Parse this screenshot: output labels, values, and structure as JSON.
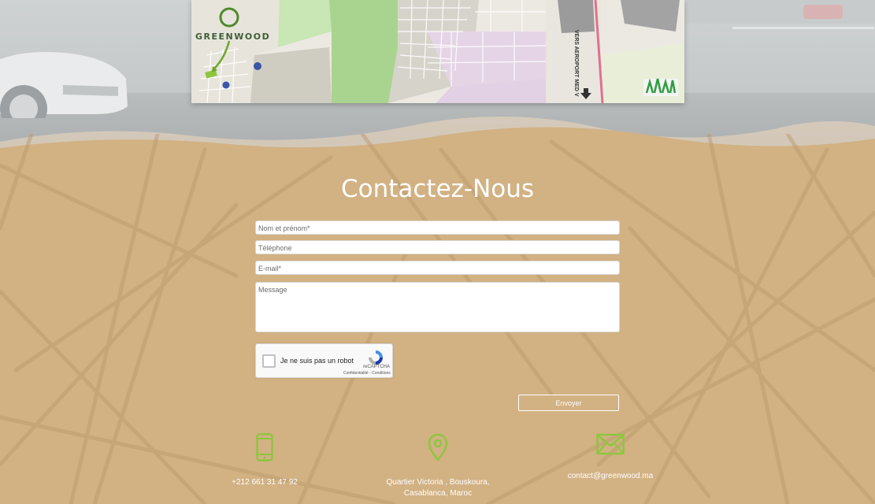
{
  "map": {
    "logo_text": "GREENWOOD",
    "road_label": "VERS AEROPORT MED V"
  },
  "contact": {
    "title": "Contactez-Nous",
    "fields": {
      "name_placeholder": "Nom et prénom*",
      "phone_placeholder": "Téléphone",
      "email_placeholder": "E-mail*",
      "message_placeholder": "Message"
    },
    "captcha": {
      "label": "Je ne suis pas un robot",
      "brand": "reCAPTCHA",
      "terms": "Confidentialité - Conditions"
    },
    "submit_label": "Envoyer"
  },
  "info": {
    "phone": "+212 661 31 47 92",
    "address_line1": "Quartier Victoria , Bouskoura,",
    "address_line2": "Casablanca, Maroc",
    "email": "contact@greenwood.ma",
    "icon_color": "#8dc63f"
  },
  "colors": {
    "section_bg": "#d2b183",
    "accent_green": "#8dc63f"
  },
  "icons": [
    "phone-icon",
    "location-pin-icon",
    "envelope-icon"
  ]
}
